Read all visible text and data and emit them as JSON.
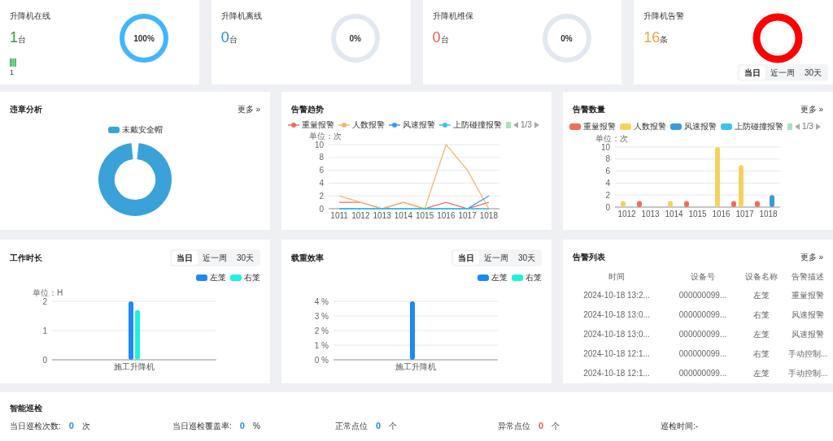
{
  "stats": [
    {
      "title": "升降机在线",
      "value": "1",
      "unit": "台",
      "color": "#2e9d3b",
      "ring": {
        "kind": "percent",
        "label": "100%",
        "level": 1,
        "color": "#41b6ff"
      },
      "mini": {
        "label": "1"
      }
    },
    {
      "title": "升降机离线",
      "value": "0",
      "unit": "台",
      "color": "#2a8bd8",
      "ring": {
        "kind": "percent",
        "label": "0%"
      }
    },
    {
      "title": "升降机维保",
      "value": "0",
      "unit": "台",
      "color": "#ee5a4a",
      "ring": {
        "kind": "percent",
        "label": "0%"
      }
    },
    {
      "title": "升降机告警",
      "value": "16",
      "unit": "条",
      "color": "#e8a54b",
      "ring": {
        "kind": "solid",
        "color": "#ff0000"
      },
      "tabs": [
        {
          "label": "当日",
          "selected": true
        },
        {
          "label": "近一周",
          "selected": false
        },
        {
          "label": "30天",
          "selected": false
        }
      ]
    }
  ],
  "violations": {
    "title": "违章分析",
    "more": "更多 »",
    "legend": [
      {
        "label": "未戴安全帽",
        "color": "#3aa1d9"
      }
    ]
  },
  "trend": {
    "title": "告警趋势",
    "page": "1/3",
    "chart_data": {
      "type": "line",
      "grid": true,
      "ylabel": "单位：次",
      "categories": [
        "1011",
        "1012",
        "1013",
        "1014",
        "1015",
        "1016",
        "1017",
        "1018"
      ],
      "ylim": [
        0,
        10
      ],
      "yticks": [
        0,
        2,
        4,
        6,
        8,
        10
      ],
      "series": [
        {
          "name": "重量报警",
          "color": "#f26c5a",
          "values": [
            1,
            1,
            0,
            1,
            0,
            1,
            0,
            1
          ]
        },
        {
          "name": "人数报警",
          "color": "#f3b66c",
          "values": [
            2,
            1,
            0,
            1,
            0,
            10,
            6,
            0
          ]
        },
        {
          "name": "风速报警",
          "color": "#3a9bdc",
          "values": [
            0,
            0,
            0,
            0,
            0,
            0,
            0,
            2
          ]
        },
        {
          "name": "上防碰撞报警",
          "color": "#3cc3ea",
          "values": [
            0,
            0,
            0,
            0,
            0,
            0,
            0,
            0
          ]
        }
      ]
    }
  },
  "count": {
    "title": "告警数量",
    "more": "更多 »",
    "page": "1/3",
    "chart_data": {
      "type": "bar",
      "grid": true,
      "ylabel": "单位：次",
      "categories": [
        "1012",
        "1013",
        "1014",
        "1015",
        "1016",
        "1017",
        "1018"
      ],
      "ylim": [
        0,
        10
      ],
      "yticks": [
        0,
        2,
        4,
        6,
        8,
        10
      ],
      "series": [
        {
          "name": "重量报警",
          "color": "#f26c5a",
          "values": [
            0,
            1,
            0,
            1,
            0,
            1,
            1
          ]
        },
        {
          "name": "人数报警",
          "color": "#f5d25f",
          "values": [
            1,
            0,
            1,
            0,
            10,
            7,
            0
          ]
        },
        {
          "name": "风速报警",
          "color": "#3a9bdc",
          "values": [
            0,
            0,
            0,
            0,
            0,
            0,
            2
          ]
        },
        {
          "name": "上防碰撞报警",
          "color": "#3cc3ea",
          "values": [
            0,
            0,
            0,
            0,
            0,
            0,
            0
          ]
        }
      ]
    }
  },
  "duration": {
    "title": "工作时长",
    "tabs": [
      {
        "label": "当日",
        "selected": true
      },
      {
        "label": "近一周",
        "selected": false
      },
      {
        "label": "30天",
        "selected": false
      }
    ],
    "chart_data": {
      "type": "bar",
      "grid": true,
      "ylabel": "单位：H",
      "categories": [
        "施工升降机"
      ],
      "ylim": [
        0,
        2
      ],
      "yticks": [
        0,
        1,
        2
      ],
      "series": [
        {
          "name": "左笼",
          "color": "#1e88f5",
          "values": [
            2
          ]
        },
        {
          "name": "右笼",
          "color": "#1ff2dc",
          "values": [
            1.7
          ]
        }
      ]
    }
  },
  "load": {
    "title": "载重效率",
    "tabs": [
      {
        "label": "当日",
        "selected": true
      },
      {
        "label": "近一周",
        "selected": false
      },
      {
        "label": "30天",
        "selected": false
      }
    ],
    "chart_data": {
      "type": "bar",
      "grid": true,
      "categories": [
        "施工升降机"
      ],
      "ylim": [
        0,
        4
      ],
      "yticks": [
        {
          "value": 0,
          "label": "0 %"
        },
        {
          "value": 1,
          "label": "1 %"
        },
        {
          "value": 2,
          "label": "2 %"
        },
        {
          "value": 3,
          "label": "3 %"
        },
        {
          "value": 4,
          "label": "4 %"
        }
      ],
      "series": [
        {
          "name": "左笼",
          "color": "#1e88f5",
          "values": [
            4
          ]
        },
        {
          "name": "右笼",
          "color": "#1ff2dc",
          "values": [
            0
          ]
        }
      ]
    }
  },
  "alarm_list": {
    "title": "告警列表",
    "more": "更多 »",
    "columns": [
      "时间",
      "设备号",
      "设备名称",
      "告警描述"
    ],
    "rows": [
      [
        "2024-10-18 13:2...",
        "000000099...",
        "左笼",
        "重量报警"
      ],
      [
        "2024-10-18 13:0...",
        "000000099...",
        "右笼",
        "风速报警"
      ],
      [
        "2024-10-18 13:0...",
        "000000099...",
        "左笼",
        "风速报警"
      ],
      [
        "2024-10-18 12:1...",
        "000000099...",
        "右笼",
        "手动控制..."
      ],
      [
        "2024-10-18 12:1...",
        "000000099...",
        "左笼",
        "手动控制..."
      ]
    ]
  },
  "patrol": {
    "title": "智能巡检",
    "items": [
      {
        "label": "当日巡检次数:",
        "value": "0",
        "unit": "次",
        "color": "#2a8bd8"
      },
      {
        "label": "当日巡检覆盖率:",
        "value": "0",
        "unit": "%",
        "color": "#2a8bd8"
      },
      {
        "label": "正常点位",
        "value": "0",
        "unit": "个",
        "color": "#2a8bd8"
      },
      {
        "label": "异常点位",
        "value": "0",
        "unit": "个",
        "color": "#ee5a4a"
      },
      {
        "label": "巡检时间:-"
      }
    ]
  }
}
